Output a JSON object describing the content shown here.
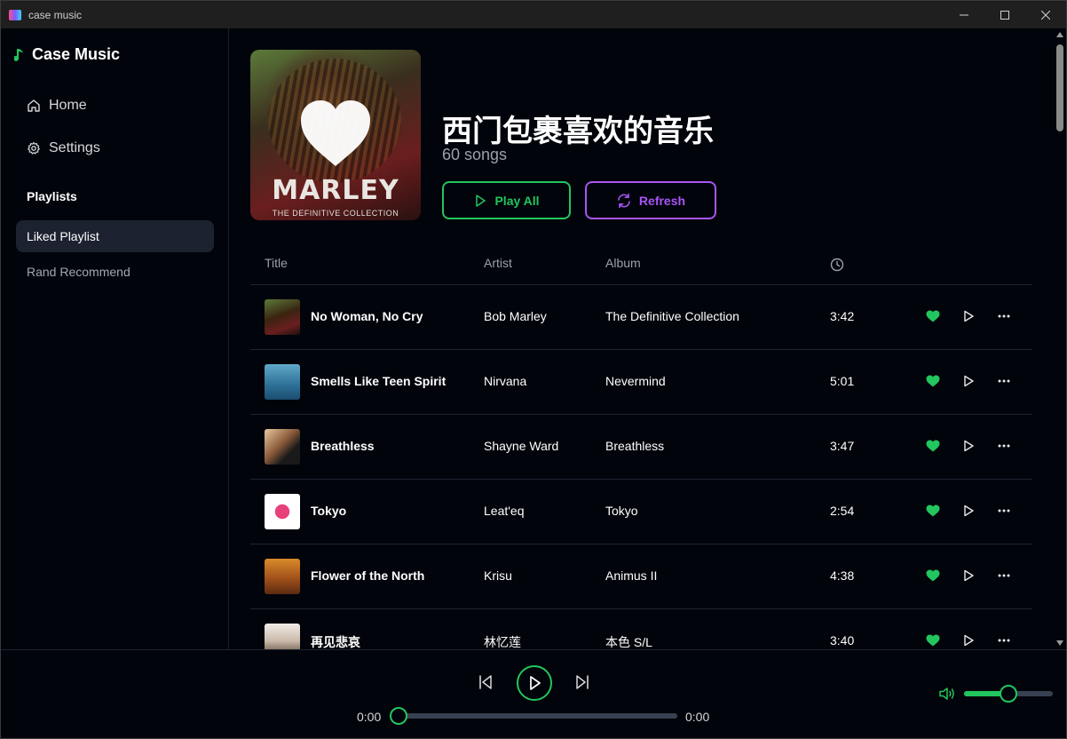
{
  "window": {
    "title": "case music"
  },
  "sidebar": {
    "brand": "Case Music",
    "nav": [
      {
        "label": "Home",
        "icon": "home-icon"
      },
      {
        "label": "Settings",
        "icon": "gear-icon"
      }
    ],
    "playlists_heading": "Playlists",
    "playlists": [
      {
        "label": "Liked Playlist",
        "active": true
      },
      {
        "label": "Rand Recommend",
        "active": false
      }
    ]
  },
  "playlist": {
    "title": "西门包裹喜欢的音乐",
    "count": "60 songs",
    "cover_title": "MARLEY",
    "cover_subtitle": "THE DEFINITIVE COLLECTION",
    "play_all": "Play All",
    "refresh": "Refresh"
  },
  "table": {
    "headers": {
      "title": "Title",
      "artist": "Artist",
      "album": "Album",
      "duration_icon": "clock-icon"
    },
    "rows": [
      {
        "title": "No Woman, No Cry",
        "artist": "Bob Marley",
        "album": "The Definitive Collection",
        "duration": "3:42",
        "liked": true
      },
      {
        "title": "Smells Like Teen Spirit",
        "artist": "Nirvana",
        "album": "Nevermind",
        "duration": "5:01",
        "liked": true
      },
      {
        "title": "Breathless",
        "artist": "Shayne Ward",
        "album": "Breathless",
        "duration": "3:47",
        "liked": true
      },
      {
        "title": "Tokyo",
        "artist": "Leat'eq",
        "album": "Tokyo",
        "duration": "2:54",
        "liked": true
      },
      {
        "title": "Flower of the North",
        "artist": "Krisu",
        "album": "Animus II",
        "duration": "4:38",
        "liked": true
      },
      {
        "title": "再见悲哀",
        "artist": "林忆莲",
        "album": "本色 S/L",
        "duration": "3:40",
        "liked": true
      }
    ]
  },
  "player": {
    "current_time": "0:00",
    "total_time": "0:00",
    "progress": 0,
    "volume": 0.5
  },
  "colors": {
    "accent": "#22c55e",
    "refresh": "#a855f7",
    "background": "#02040b",
    "active_item": "#1c2230"
  }
}
